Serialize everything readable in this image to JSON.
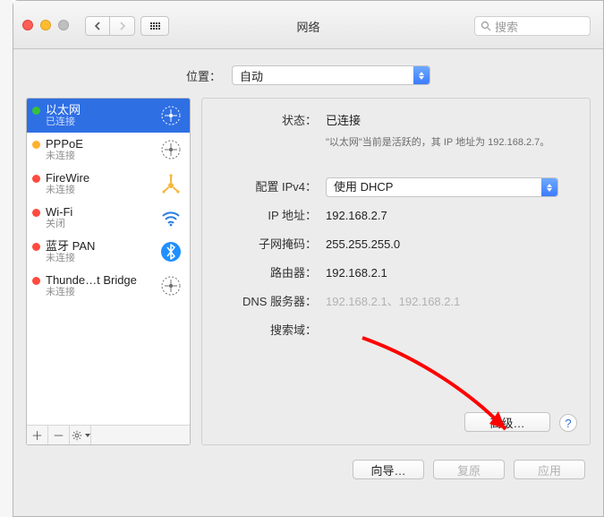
{
  "window": {
    "title": "网络",
    "search_placeholder": "搜索"
  },
  "location": {
    "label": "位置：",
    "value": "自动"
  },
  "sidebar": {
    "services": [
      {
        "name": "以太网",
        "status": "已连接",
        "dot": "green",
        "icon": "ethernet",
        "selected": true
      },
      {
        "name": "PPPoE",
        "status": "未连接",
        "dot": "orange",
        "icon": "ethernet"
      },
      {
        "name": "FireWire",
        "status": "未连接",
        "dot": "red",
        "icon": "firewire"
      },
      {
        "name": "Wi-Fi",
        "status": "关闭",
        "dot": "red",
        "icon": "wifi"
      },
      {
        "name": "蓝牙 PAN",
        "status": "未连接",
        "dot": "red",
        "icon": "bluetooth"
      },
      {
        "name": "Thunde…t Bridge",
        "status": "未连接",
        "dot": "red",
        "icon": "ethernet"
      }
    ]
  },
  "detail": {
    "status_label": "状态：",
    "status_value": "已连接",
    "status_sub": "\"以太网\"当前是活跃的，其 IP 地址为 192.168.2.7。",
    "ipv4cfg_label": "配置 IPv4：",
    "ipv4cfg_value": "使用 DHCP",
    "ip_label": "IP 地址：",
    "ip_value": "192.168.2.7",
    "mask_label": "子网掩码：",
    "mask_value": "255.255.255.0",
    "router_label": "路由器：",
    "router_value": "192.168.2.1",
    "dns_label": "DNS 服务器：",
    "dns_value": "192.168.2.1、192.168.2.1",
    "search_label": "搜索域：",
    "search_value": "",
    "advanced_label": "高级…",
    "help_label": "?"
  },
  "actions": {
    "wizard": "向导…",
    "revert": "复原",
    "apply": "应用"
  }
}
